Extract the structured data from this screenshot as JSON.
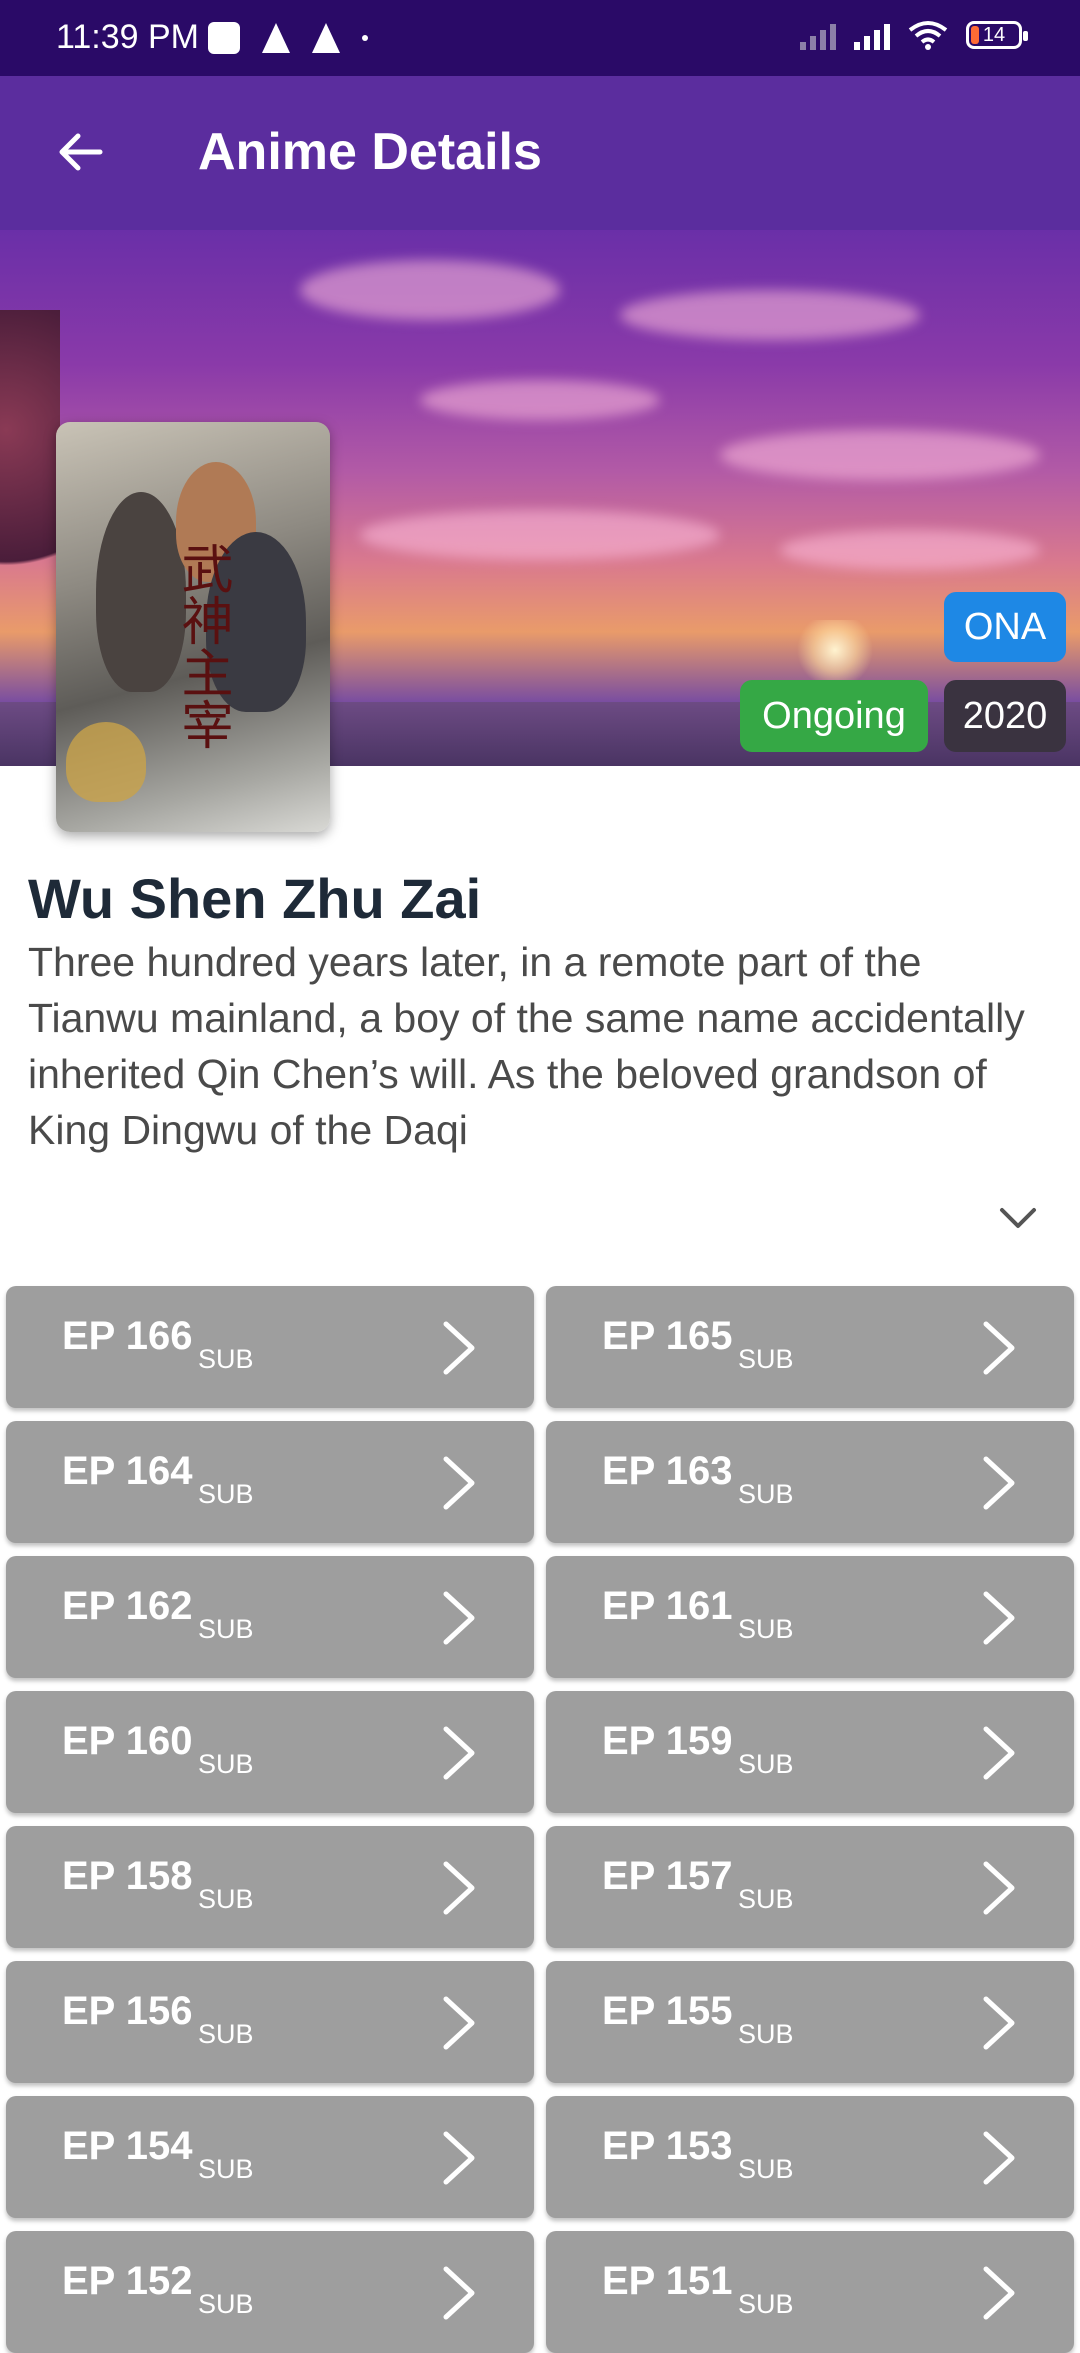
{
  "status_bar": {
    "time": "11:39 PM",
    "battery": "14",
    "icons": [
      "notification-square-icon",
      "navigation-arrow-icon",
      "navigation-arrow-icon",
      "dot-icon",
      "no-signal-icon",
      "signal-icon",
      "wifi-icon",
      "battery-icon"
    ]
  },
  "app_bar": {
    "title": "Anime Details",
    "back_icon": "arrow-left-icon"
  },
  "anime": {
    "type": "ONA",
    "status": "Ongoing",
    "year": "2020",
    "poster_text": "武神主宰",
    "title": "Wu Shen Zhu Zai",
    "description": "Three hundred years later, in a remote part of the Tianwu mainland, a boy of the same name accidentally inherited Qin Chen’s will. As the beloved grandson of King Dingwu of the Daqi",
    "expand_icon": "chevron-down-icon"
  },
  "episodes": [
    {
      "label": "EP 166",
      "tag": "SUB"
    },
    {
      "label": "EP 165",
      "tag": "SUB"
    },
    {
      "label": "EP 164",
      "tag": "SUB"
    },
    {
      "label": "EP 163",
      "tag": "SUB"
    },
    {
      "label": "EP 162",
      "tag": "SUB"
    },
    {
      "label": "EP 161",
      "tag": "SUB"
    },
    {
      "label": "EP 160",
      "tag": "SUB"
    },
    {
      "label": "EP 159",
      "tag": "SUB"
    },
    {
      "label": "EP 158",
      "tag": "SUB"
    },
    {
      "label": "EP 157",
      "tag": "SUB"
    },
    {
      "label": "EP 156",
      "tag": "SUB"
    },
    {
      "label": "EP 155",
      "tag": "SUB"
    },
    {
      "label": "EP 154",
      "tag": "SUB"
    },
    {
      "label": "EP 153",
      "tag": "SUB"
    },
    {
      "label": "EP 152",
      "tag": "SUB"
    },
    {
      "label": "EP 151",
      "tag": "SUB"
    }
  ],
  "colors": {
    "status_bar": "#2a0a67",
    "app_bar": "#5b2d9e",
    "badge_type": "#1e88e5",
    "badge_status": "#35a845",
    "badge_year": "#3a3340",
    "episode_card": "#9e9e9e"
  }
}
